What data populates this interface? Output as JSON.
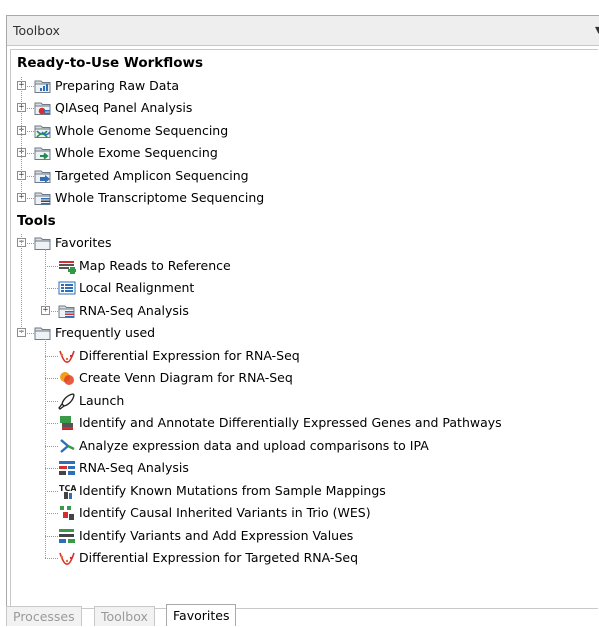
{
  "panel": {
    "title": "Toolbox"
  },
  "workflows": {
    "heading": "Ready-to-Use Workflows",
    "items": [
      {
        "label": "Preparing Raw Data",
        "icon": "folder-chart-icon"
      },
      {
        "label": "QIAseq Panel Analysis",
        "icon": "folder-qiaseq-icon"
      },
      {
        "label": "Whole Genome Sequencing",
        "icon": "folder-genome-icon"
      },
      {
        "label": "Whole Exome Sequencing",
        "icon": "folder-exome-icon"
      },
      {
        "label": "Targeted Amplicon Sequencing",
        "icon": "folder-amplicon-icon"
      },
      {
        "label": "Whole Transcriptome Sequencing",
        "icon": "folder-transcriptome-icon"
      }
    ]
  },
  "tools": {
    "heading": "Tools",
    "favorites": {
      "label": "Favorites",
      "items": [
        {
          "label": "Map Reads to Reference",
          "icon": "map-reads-icon"
        },
        {
          "label": "Local Realignment",
          "icon": "local-realignment-icon"
        },
        {
          "label": "RNA-Seq Analysis",
          "icon": "folder-rnaseq-icon"
        }
      ]
    },
    "frequent": {
      "label": "Frequently used",
      "items": [
        {
          "label": "Differential Expression for RNA-Seq",
          "icon": "diff-expression-icon"
        },
        {
          "label": "Create Venn Diagram for RNA-Seq",
          "icon": "venn-diagram-icon"
        },
        {
          "label": "Launch",
          "icon": "rocket-icon"
        },
        {
          "label": "Identify and Annotate Differentially Expressed Genes and Pathways",
          "icon": "workflow-icon"
        },
        {
          "label": "Analyze expression data and upload comparisons to IPA",
          "icon": "ipa-upload-icon"
        },
        {
          "label": "RNA-Seq Analysis",
          "icon": "rnaseq-icon"
        },
        {
          "label": "Identify Known Mutations from Sample Mappings",
          "icon": "known-mutations-icon"
        },
        {
          "label": "Identify Causal Inherited Variants in Trio (WES)",
          "icon": "trio-variants-icon"
        },
        {
          "label": "Identify Variants and Add Expression Values",
          "icon": "variants-expression-icon"
        },
        {
          "label": "Differential Expression for Targeted RNA-Seq",
          "icon": "diff-expression-icon"
        }
      ]
    }
  },
  "tabs": [
    {
      "label": "Processes",
      "active": false
    },
    {
      "label": "Toolbox",
      "active": false
    },
    {
      "label": "Favorites",
      "active": true
    }
  ]
}
